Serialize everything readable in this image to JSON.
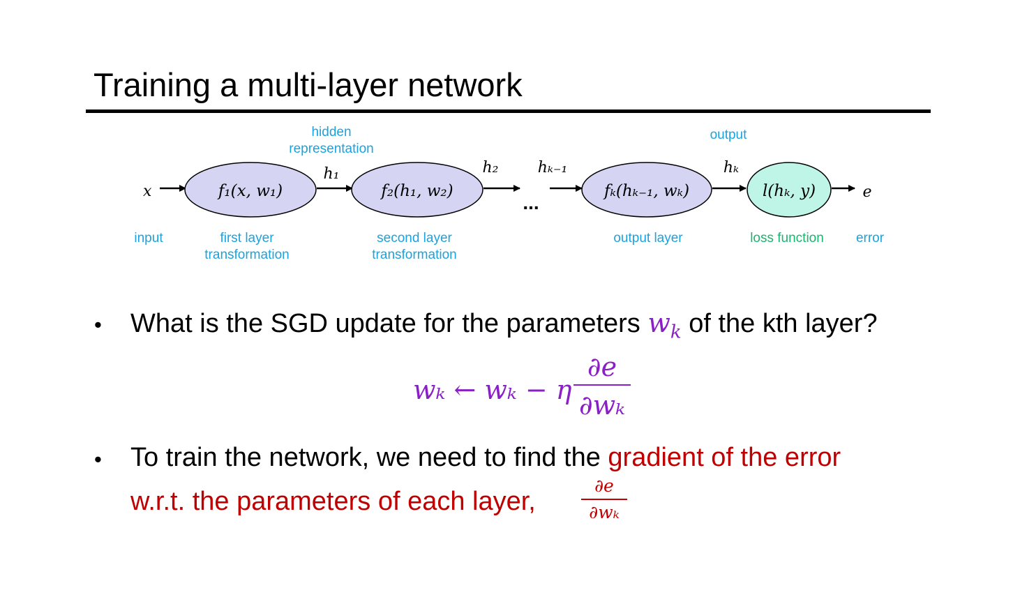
{
  "slide": {
    "title": "Training a multi-layer network"
  },
  "diagram": {
    "input_symbol": "x",
    "output_symbol": "e",
    "ellipsis": "...",
    "nodes": [
      {
        "id": "f1",
        "formula": "f₁(x, w₁)",
        "caption_line1": "first layer",
        "caption_line2": "transformation",
        "fill": "#D5D5F3"
      },
      {
        "id": "f2",
        "formula": "f₂(h₁, w₂)",
        "caption_line1": "second layer",
        "caption_line2": "transformation",
        "fill": "#D5D5F3"
      },
      {
        "id": "fK",
        "formula": "fₖ(hₖ₋₁, wₖ)",
        "caption_line1": "output layer",
        "caption_line2": "",
        "fill": "#D5D5F3"
      },
      {
        "id": "loss",
        "formula": "l(hₖ, y)",
        "caption_line1": "loss function",
        "caption_line2": "",
        "fill": "#BFF5E6"
      }
    ],
    "edge_labels": {
      "h1": "h₁",
      "h2": "h₂",
      "hK_minus_1": "hₖ₋₁",
      "hK": "hₖ"
    },
    "captions": {
      "input": "input",
      "error": "error",
      "hidden_line1": "hidden",
      "hidden_line2": "representation",
      "output": "output"
    },
    "colors": {
      "caption_blue": "#1AA3DD",
      "caption_green": "#1AB56F",
      "node_outline": "#000000"
    }
  },
  "bullets": {
    "b1_pre": "What is the SGD update for the parameters ",
    "b1_var": "w",
    "b1_var_sub": "k",
    "b1_post": " of the kth layer?",
    "b2_line1_pre": "To train the network, we need to find the ",
    "b2_line1_red": "gradient of the error",
    "b2_line2_red": "w.r.t. the parameters of each layer,"
  },
  "equation": {
    "lhs": "wₖ ← wₖ − η",
    "numerator": "∂e",
    "denominator": "∂wₖ",
    "color": "#8A1FC7"
  },
  "inline_fraction": {
    "numerator": "∂e",
    "denominator": "∂wₖ",
    "color": "#C00000"
  }
}
